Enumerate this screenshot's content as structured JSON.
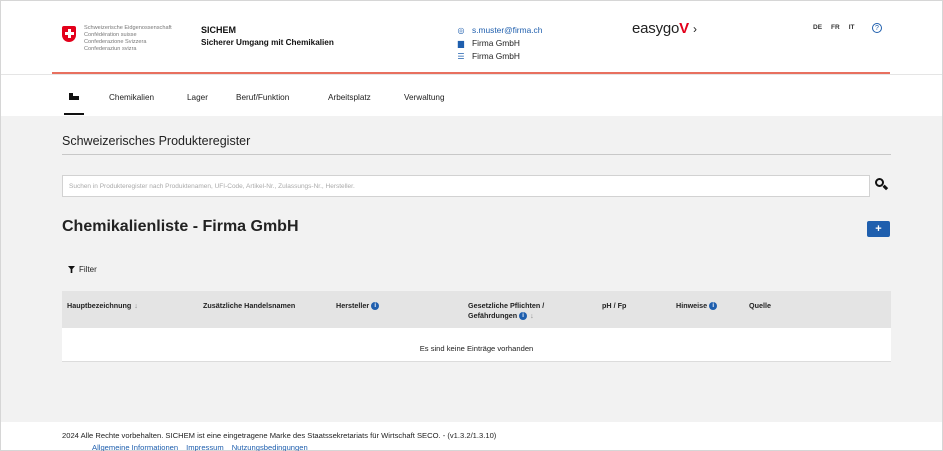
{
  "header": {
    "confederation": [
      "Schweizerische Eidgenossenschaft",
      "Confédération suisse",
      "Confederazione Svizzera",
      "Confederaziun svizra"
    ],
    "brand_title": "SICHEM",
    "brand_subtitle": "Sicherer Umgang mit Chemikalien",
    "user_email": "s.muster@firma.ch",
    "company_1": "Firma GmbH",
    "company_2": "Firma GmbH",
    "easygov_prefix": "easygo",
    "easygov_v": "V",
    "easygov_arrow": "›",
    "languages": [
      "DE",
      "FR",
      "IT"
    ],
    "help_symbol": "?"
  },
  "nav": {
    "home_icon": "factory-icon",
    "items": [
      "Chemikalien",
      "Lager",
      "Beruf/Funktion",
      "Arbeitsplatz",
      "Verwaltung"
    ]
  },
  "main": {
    "section_title": "Schweizerisches Produkteregister",
    "search_placeholder": "Suchen in Produkteregister nach Produktenamen, UFI-Code, Artikel-Nr., Zulassungs-Nr., Hersteller.",
    "list_title": "Chemikalienliste - Firma GmbH",
    "add_button": "+",
    "filter_label": "Filter",
    "table": {
      "columns": {
        "hauptbezeichnung": "Hauptbezeichnung",
        "handelsnamen": "Zusätzliche Handelsnamen",
        "hersteller": "Hersteller",
        "pflichten_line1": "Gesetzliche Pflichten /",
        "pflichten_line2": "Gefährdungen",
        "ph": "pH / Fp",
        "hinweise": "Hinweise",
        "quelle": "Quelle"
      },
      "info_symbol": "i",
      "sort_symbol": "↓",
      "empty_message": "Es sind keine Einträge vorhanden"
    }
  },
  "footer": {
    "copyright": "2024 Alle Rechte vorbehalten. SICHEM ist eine eingetragene Marke des Staatssekretariats für Wirtschaft SECO. - (v1.3.2/1.3.10)",
    "links": [
      "Allgemeine Informationen",
      "Impressum",
      "Nutzungsbedingungen"
    ]
  },
  "colors": {
    "accent_blue": "#1f5fae",
    "swiss_red": "#e3001b",
    "header_rule": "#e8705f",
    "content_bg": "#f2f2f2"
  }
}
